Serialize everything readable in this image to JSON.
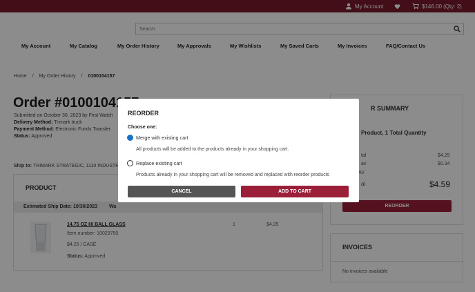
{
  "header": {
    "my_account": "My Account",
    "cart_summary": "$146.00 (Qty: 2)",
    "search_placeholder": "Search"
  },
  "nav": [
    "My Account",
    "My Catalog",
    "My Order History",
    "My Approvals",
    "My Wishlists",
    "My Saved Carts",
    "My Invoices",
    "FAQ/Contact Us"
  ],
  "breadcrumb": {
    "home": "Home",
    "sep": "/",
    "history": "My Order History",
    "current": "0100104157"
  },
  "order": {
    "title": "Order #0100104157",
    "submitted": "Submitted on October 30, 2023 by First Watch",
    "delivery_label": "Delivery Method:",
    "delivery_value": "Trimark truck",
    "payment_label": "Payment Method:",
    "payment_value": "Electronic Funds Transfer",
    "status_label": "Status:",
    "status_value": "Approved",
    "ship_to_label": "Ship to:",
    "ship_to_value": "TRIMARK STRATEGIC, 1110 INDUSTRY AVE"
  },
  "product_panel": {
    "header": "PRODUCT",
    "est_ship": "Estimated Ship Date: 10/30/2023",
    "wa": "Wa",
    "item": {
      "name": "14.75 OZ HI BALL GLASS",
      "item_number": "Item number: 10029750",
      "price_unit": "$4.25 / CASE",
      "status_label": "Status:",
      "status_value": "Approved",
      "qty": "1",
      "total": "$4.25"
    }
  },
  "summary": {
    "header": "R SUMMARY",
    "line": "Product, 1 Total Quantity",
    "subtotal_label": "tal",
    "subtotal": "$4.25",
    "tax_label": "ax",
    "tax": "$0.34",
    "av": "AV",
    "total_label": "al",
    "total": "$4.59",
    "reorder": "REORDER"
  },
  "invoices": {
    "header": "INVOICES",
    "empty": "No invoices available"
  },
  "modal": {
    "title": "REORDER",
    "choose": "Choose one:",
    "opt1_label": "Merge with existing cart",
    "opt1_desc": "All products will be added to the products already in your shopping cart.",
    "opt2_label": "Replace existing cart",
    "opt2_desc": "Products already in your shopping cart will be removed and replaced with reorder products",
    "cancel": "CANCEL",
    "add": "ADD TO CART"
  },
  "colors": {
    "brand": "#7a1a2c",
    "button_primary": "#9b1f38",
    "button_secondary": "#555555",
    "radio_selected": "#1a72c4"
  }
}
